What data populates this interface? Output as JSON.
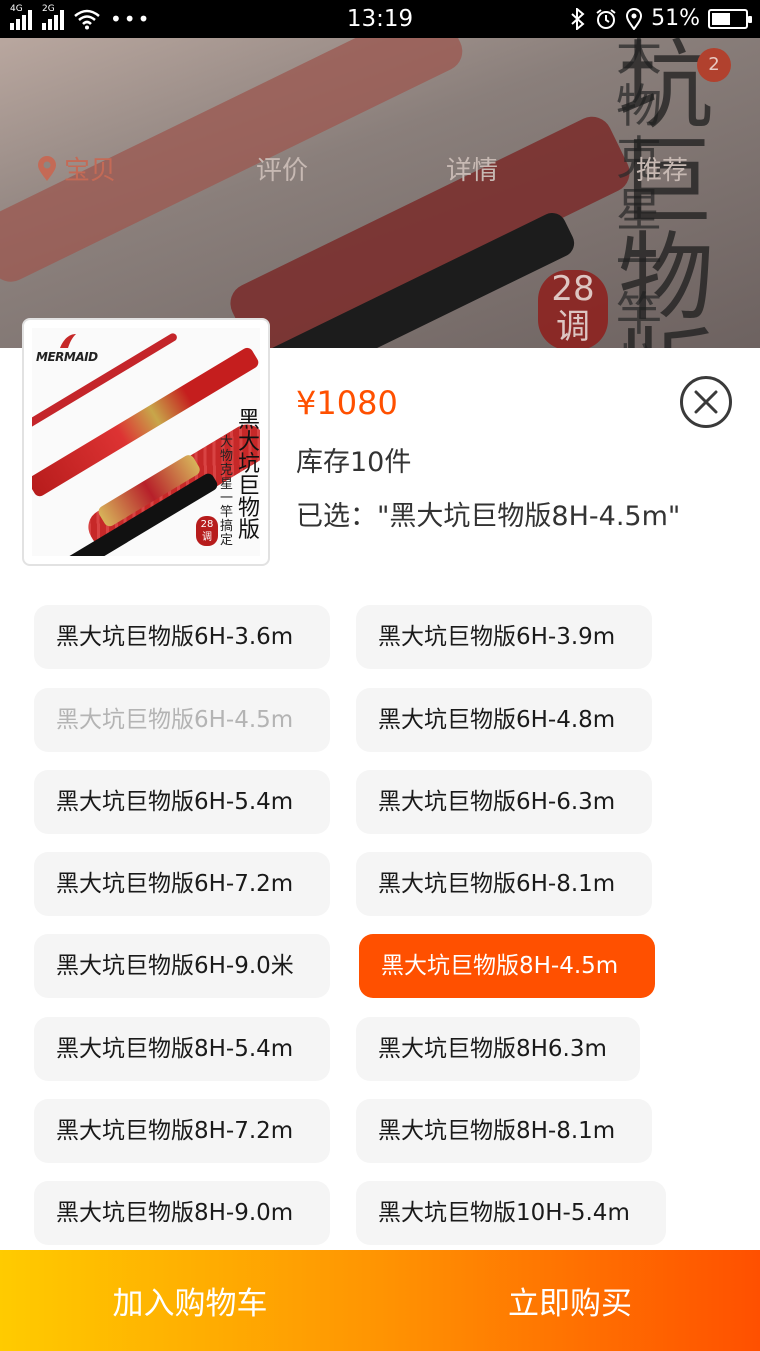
{
  "status_bar": {
    "network_1": "4G",
    "network_2": "2G",
    "more": "•••",
    "time": "13:19",
    "battery": "51%"
  },
  "background_page": {
    "tabs": [
      "宝贝",
      "评价",
      "详情",
      "推荐"
    ],
    "cart_count": "2",
    "banner_big_text": "坑巨物版",
    "banner_side_text": "大物克星一竿搞",
    "banner_seal": "28调"
  },
  "product": {
    "thumbnail_brand": "MERMAID",
    "thumbnail_title": "黑大坑巨物版",
    "thumbnail_slogan": "大物克星一竿搞定",
    "thumbnail_seal": "28调",
    "price": "¥1080",
    "stock": "库存10件",
    "selected": "已选：\"黑大坑巨物版8H-4.5m\""
  },
  "options": [
    {
      "label": "黑大坑巨物版6H-3.6m",
      "state": "normal"
    },
    {
      "label": "黑大坑巨物版6H-3.9m",
      "state": "normal"
    },
    {
      "label": "黑大坑巨物版6H-4.5m",
      "state": "disabled"
    },
    {
      "label": "黑大坑巨物版6H-4.8m",
      "state": "normal"
    },
    {
      "label": "黑大坑巨物版6H-5.4m",
      "state": "normal"
    },
    {
      "label": "黑大坑巨物版6H-6.3m",
      "state": "normal"
    },
    {
      "label": "黑大坑巨物版6H-7.2m",
      "state": "normal"
    },
    {
      "label": "黑大坑巨物版6H-8.1m",
      "state": "normal"
    },
    {
      "label": "黑大坑巨物版6H-9.0米",
      "state": "normal"
    },
    {
      "label": "黑大坑巨物版8H-4.5m",
      "state": "selected"
    },
    {
      "label": "黑大坑巨物版8H-5.4m",
      "state": "normal"
    },
    {
      "label": "黑大坑巨物版8H6.3m",
      "state": "normal"
    },
    {
      "label": "黑大坑巨物版8H-7.2m",
      "state": "normal"
    },
    {
      "label": "黑大坑巨物版8H-8.1m",
      "state": "normal"
    },
    {
      "label": "黑大坑巨物版8H-9.0m",
      "state": "normal"
    },
    {
      "label": "黑大坑巨物版10H-5.4m",
      "state": "normal"
    }
  ],
  "footer": {
    "add_to_cart": "加入购物车",
    "buy_now": "立即购买"
  },
  "colors": {
    "accent": "#ff5000",
    "cart_button": "#ffb000",
    "chip_bg": "#f5f5f5"
  }
}
